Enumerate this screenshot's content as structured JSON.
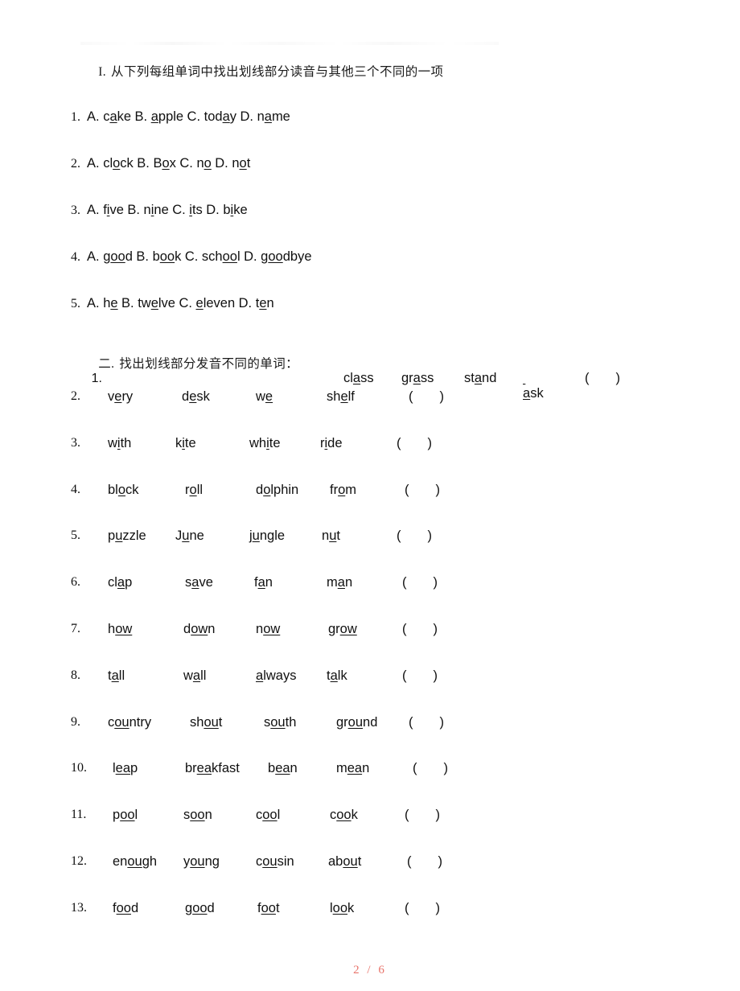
{
  "document": {
    "page_indicator": "2 / 6",
    "page_number": 2,
    "page_total": 6
  },
  "section_one": {
    "heading_prefix": "I.",
    "heading_text": "从下列每组单词中找出划线部分读音与其他三个不同的一项",
    "items": [
      {
        "number": "1.",
        "choices": [
          {
            "label": "A.",
            "pre": "c",
            "mark": "a",
            "post": "ke"
          },
          {
            "label": "B.",
            "pre": "",
            "mark": "a",
            "post": "pple"
          },
          {
            "label": "C.",
            "pre": "tod",
            "mark": "a",
            "post": "y"
          },
          {
            "label": "D.",
            "pre": "n",
            "mark": "a",
            "post": "me"
          }
        ]
      },
      {
        "number": "2.",
        "choices": [
          {
            "label": "A.",
            "pre": "cl",
            "mark": "o",
            "post": "ck"
          },
          {
            "label": "B.",
            "pre": "B",
            "mark": "o",
            "post": "x"
          },
          {
            "label": "C.",
            "pre": "n",
            "mark": "o",
            "post": ""
          },
          {
            "label": "D.",
            "pre": "n",
            "mark": "o",
            "post": "t"
          }
        ]
      },
      {
        "number": "3.",
        "choices": [
          {
            "label": "A.",
            "pre": "f",
            "mark": "i",
            "post": "ve"
          },
          {
            "label": "B.",
            "pre": "n",
            "mark": "i",
            "post": "ne"
          },
          {
            "label": "C.",
            "pre": "",
            "mark": "i",
            "post": "ts"
          },
          {
            "label": "D.",
            "pre": "b",
            "mark": "i",
            "post": "ke"
          }
        ]
      },
      {
        "number": "4.",
        "choices": [
          {
            "label": "A.",
            "pre": "g",
            "mark": "oo",
            "post": "d"
          },
          {
            "label": "B.",
            "pre": "b",
            "mark": "oo",
            "post": "k"
          },
          {
            "label": "C.",
            "pre": "sch",
            "mark": "oo",
            "post": "l"
          },
          {
            "label": "D.",
            "pre": "g",
            "mark": "oo",
            "post": "dbye"
          }
        ]
      },
      {
        "number": "5.",
        "choices": [
          {
            "label": "A.",
            "pre": "h",
            "mark": "e",
            "post": ""
          },
          {
            "label": "B.",
            "pre": "tw",
            "mark": "e",
            "post": "lve"
          },
          {
            "label": "C.",
            "pre": "",
            "mark": "e",
            "post": "leven"
          },
          {
            "label": "D.",
            "pre": "t",
            "mark": "e",
            "post": "n"
          }
        ]
      }
    ]
  },
  "section_two": {
    "heading_prefix": "二.",
    "heading_text": "找出划线部分发音不同的单词：",
    "bracket_open": "(",
    "bracket_close": ")",
    "items": [
      {
        "number": "1.",
        "inline_with_heading": true,
        "words": [
          {
            "pre": "cl",
            "mark": "a",
            "post": "ss"
          },
          {
            "pre": "gr",
            "mark": "a",
            "post": "ss"
          },
          {
            "pre": "st",
            "mark": "a",
            "post": "nd"
          },
          {
            "pre": "",
            "mark": "a",
            "post": "sk",
            "lead_underscore": true
          }
        ]
      },
      {
        "number": "2.",
        "words": [
          {
            "pre": "v",
            "mark": "e",
            "post": "ry"
          },
          {
            "pre": "d",
            "mark": "e",
            "post": "sk"
          },
          {
            "pre": "w",
            "mark": "e",
            "post": ""
          },
          {
            "pre": "sh",
            "mark": "e",
            "post": "lf"
          }
        ]
      },
      {
        "number": "3.",
        "words": [
          {
            "pre": "w",
            "mark": "i",
            "post": "th"
          },
          {
            "pre": "k",
            "mark": "i",
            "post": "te"
          },
          {
            "pre": "wh",
            "mark": "i",
            "post": "te"
          },
          {
            "pre": "r",
            "mark": "i",
            "post": "de"
          }
        ]
      },
      {
        "number": "4.",
        "words": [
          {
            "pre": "bl",
            "mark": "o",
            "post": "ck"
          },
          {
            "pre": "r",
            "mark": "o",
            "post": "ll"
          },
          {
            "pre": "d",
            "mark": "o",
            "post": "lphin"
          },
          {
            "pre": "fr",
            "mark": "o",
            "post": "m"
          }
        ]
      },
      {
        "number": "5.",
        "words": [
          {
            "pre": "p",
            "mark": "u",
            "post": "zzle"
          },
          {
            "pre": "J",
            "mark": "u",
            "post": "ne"
          },
          {
            "pre": "j",
            "mark": "u",
            "post": "ngle"
          },
          {
            "pre": "n",
            "mark": "u",
            "post": "t"
          }
        ]
      },
      {
        "number": "6.",
        "words": [
          {
            "pre": "cl",
            "mark": "a",
            "post": "p"
          },
          {
            "pre": "s",
            "mark": "a",
            "post": "ve"
          },
          {
            "pre": "f",
            "mark": "a",
            "post": "n"
          },
          {
            "pre": "m",
            "mark": "a",
            "post": "n"
          }
        ]
      },
      {
        "number": "7.",
        "words": [
          {
            "pre": "h",
            "mark": "ow",
            "post": ""
          },
          {
            "pre": "d",
            "mark": "ow",
            "post": "n"
          },
          {
            "pre": "n",
            "mark": "ow",
            "post": ""
          },
          {
            "pre": "gr",
            "mark": "ow",
            "post": ""
          }
        ]
      },
      {
        "number": "8.",
        "words": [
          {
            "pre": "t",
            "mark": "a",
            "post": "ll"
          },
          {
            "pre": "w",
            "mark": "a",
            "post": "ll"
          },
          {
            "pre": "",
            "mark": "a",
            "post": "lways"
          },
          {
            "pre": "t",
            "mark": "a",
            "post": "lk"
          }
        ]
      },
      {
        "number": "9.",
        "words": [
          {
            "pre": "c",
            "mark": "ou",
            "post": "ntry"
          },
          {
            "pre": "sh",
            "mark": "ou",
            "post": "t"
          },
          {
            "pre": "s",
            "mark": "ou",
            "post": "th"
          },
          {
            "pre": "gr",
            "mark": "ou",
            "post": "nd"
          }
        ]
      },
      {
        "number": "10.",
        "words": [
          {
            "pre": "l",
            "mark": "ea",
            "post": "p"
          },
          {
            "pre": "br",
            "mark": "ea",
            "post": "kfast"
          },
          {
            "pre": "b",
            "mark": "ea",
            "post": "n"
          },
          {
            "pre": "m",
            "mark": "ea",
            "post": "n"
          }
        ]
      },
      {
        "number": "11.",
        "words": [
          {
            "pre": "p",
            "mark": "oo",
            "post": "l"
          },
          {
            "pre": "s",
            "mark": "oo",
            "post": "n"
          },
          {
            "pre": "c",
            "mark": "oo",
            "post": "l"
          },
          {
            "pre": "c",
            "mark": "oo",
            "post": "k"
          }
        ]
      },
      {
        "number": "12.",
        "words": [
          {
            "pre": "en",
            "mark": "ou",
            "post": "gh"
          },
          {
            "pre": "y",
            "mark": "ou",
            "post": "ng"
          },
          {
            "pre": "c",
            "mark": "ou",
            "post": "sin"
          },
          {
            "pre": "ab",
            "mark": "ou",
            "post": "t"
          }
        ]
      },
      {
        "number": "13.",
        "words": [
          {
            "pre": "f",
            "mark": "oo",
            "post": "d"
          },
          {
            "pre": "g",
            "mark": "oo",
            "post": "d"
          },
          {
            "pre": "f",
            "mark": "oo",
            "post": "t"
          },
          {
            "pre": "l",
            "mark": "oo",
            "post": "k"
          }
        ]
      }
    ]
  }
}
